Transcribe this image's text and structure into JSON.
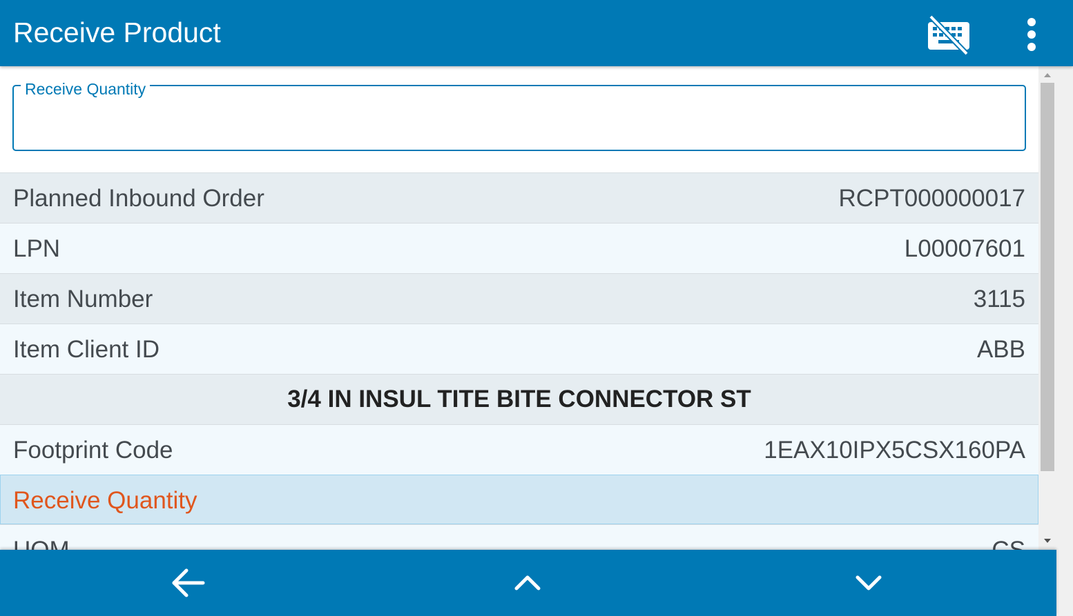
{
  "header": {
    "title": "Receive Product",
    "icons": [
      "keyboard-off-icon",
      "more-vert-icon"
    ]
  },
  "input": {
    "label": "Receive Quantity",
    "value": ""
  },
  "rows": [
    {
      "label": "Planned Inbound Order",
      "value": "RCPT000000017"
    },
    {
      "label": "LPN",
      "value": "L00007601"
    },
    {
      "label": "Item Number",
      "value": "3115"
    },
    {
      "label": "Item Client ID",
      "value": "ABB"
    }
  ],
  "description": "3/4 IN INSUL TITE BITE CONNECTOR ST",
  "footprint": {
    "label": "Footprint Code",
    "value": "1EAX10IPX5CSX160PA"
  },
  "active_row": {
    "label": "Receive Quantity"
  },
  "uom": {
    "label": "UOM",
    "value": "CS"
  },
  "footer": {
    "icons": [
      "arrow-back-icon",
      "chevron-up-icon",
      "chevron-down-icon"
    ]
  },
  "colors": {
    "primary": "#0079b5",
    "active_label": "#e0561d",
    "row_odd": "#e6edf1",
    "row_even": "#f2f9fd",
    "row_active": "#d1e7f3"
  }
}
